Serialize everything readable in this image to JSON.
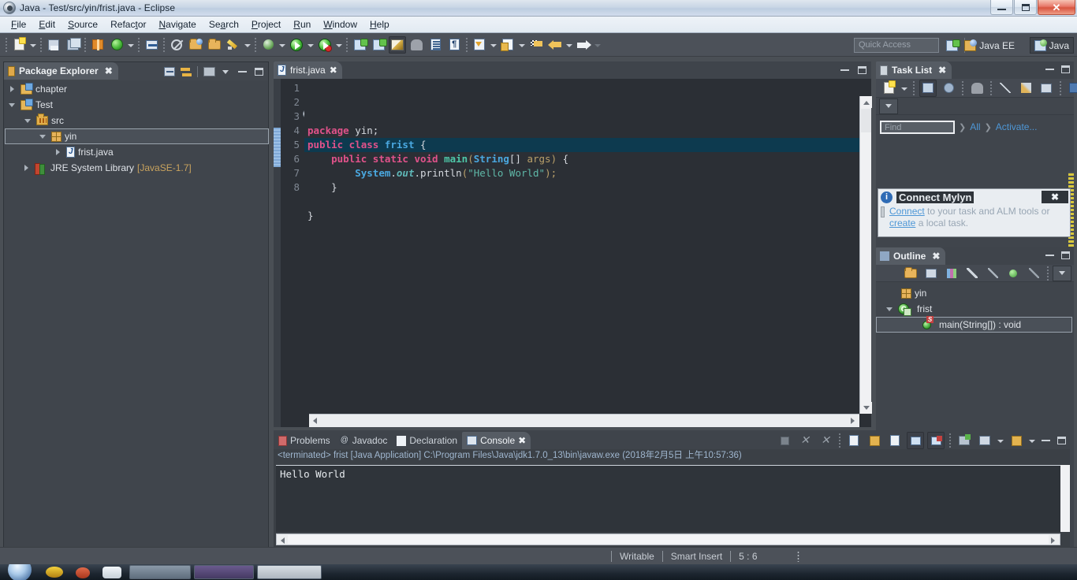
{
  "window": {
    "title": "Java - Test/src/yin/frist.java - Eclipse",
    "icon": "eclipse-icon",
    "minimize_label": "Minimize",
    "maximize_label": "Maximize",
    "close_label": "Close"
  },
  "menubar": {
    "items": [
      {
        "label": "File",
        "mnemonic": "F"
      },
      {
        "label": "Edit",
        "mnemonic": "E"
      },
      {
        "label": "Source",
        "mnemonic": "S"
      },
      {
        "label": "Refactor",
        "mnemonic": "t"
      },
      {
        "label": "Navigate",
        "mnemonic": "N"
      },
      {
        "label": "Search",
        "mnemonic": "a"
      },
      {
        "label": "Project",
        "mnemonic": "P"
      },
      {
        "label": "Run",
        "mnemonic": "R"
      },
      {
        "label": "Window",
        "mnemonic": "W"
      },
      {
        "label": "Help",
        "mnemonic": "H"
      }
    ]
  },
  "toolbar": {
    "quick_access_placeholder": "Quick Access",
    "perspective_java_ee": "Java EE",
    "perspective_java": "Java",
    "icons": [
      "new-wizard-icon",
      "save-icon",
      "save-all-icon",
      "new-java-project-icon",
      "build-refresh-icon",
      "toggle-breadcrumb-icon",
      "skip-breakpoints-icon",
      "open-type-icon",
      "open-task-icon",
      "edit-icon",
      "debug-icon",
      "run-icon",
      "run-last-tool-icon",
      "new-java-class-icon",
      "java-perspective-icon",
      "search-icon",
      "toggle-block-selection-icon",
      "show-whitespace-icon",
      "next-annotation-icon",
      "previous-annotation-icon",
      "back-icon",
      "forward-icon"
    ]
  },
  "package_explorer": {
    "title": "Package Explorer",
    "close_label": "✖",
    "tree": [
      {
        "label": "chapter",
        "icon": "java-project-icon",
        "state": "collapsed",
        "indent": 0,
        "selected": false
      },
      {
        "label": "Test",
        "icon": "java-project-icon",
        "state": "expanded",
        "indent": 0,
        "selected": false
      },
      {
        "label": "src",
        "icon": "source-folder-icon",
        "state": "expanded",
        "indent": 1,
        "selected": false
      },
      {
        "label": "yin",
        "icon": "package-icon",
        "state": "expanded",
        "indent": 2,
        "selected": true
      },
      {
        "label": "frist.java",
        "icon": "java-file-icon",
        "state": "collapsed",
        "indent": 3,
        "selected": false
      },
      {
        "label": "JRE System Library",
        "suffix": " [JavaSE-1.7]",
        "icon": "jre-library-icon",
        "state": "collapsed",
        "indent": 1,
        "selected": false
      }
    ]
  },
  "editor": {
    "tab_label": "frist.java",
    "tab_icon": "java-file-icon",
    "tab_close": "✖",
    "line_numbers": [
      "1",
      "2",
      "3",
      "4",
      "5",
      "6",
      "7",
      "8"
    ],
    "highlighted_line": 5,
    "folding_line": 3,
    "code_lines": [
      {
        "num": "1",
        "tokens": [
          {
            "t": "package",
            "c": "kw"
          },
          {
            "t": " yin;",
            "c": "pln"
          }
        ]
      },
      {
        "num": "2",
        "tokens": [
          {
            "t": "public class ",
            "c": "kw"
          },
          {
            "t": "frist",
            "c": "typ"
          },
          {
            "t": " {",
            "c": "pln"
          }
        ]
      },
      {
        "num": "3",
        "tokens": [
          {
            "t": "    ",
            "c": "pln"
          },
          {
            "t": "public static void ",
            "c": "kw"
          },
          {
            "t": "main",
            "c": "meth"
          },
          {
            "t": "(",
            "c": "par"
          },
          {
            "t": "String",
            "c": "typ"
          },
          {
            "t": "[] ",
            "c": "pln"
          },
          {
            "t": "args",
            "c": "par"
          },
          {
            "t": ") ",
            "c": "par"
          },
          {
            "t": "{",
            "c": "pln"
          }
        ]
      },
      {
        "num": "4",
        "tokens": [
          {
            "t": "        ",
            "c": "pln"
          },
          {
            "t": "System",
            "c": "typ"
          },
          {
            "t": ".",
            "c": "pln"
          },
          {
            "t": "out",
            "c": "fld"
          },
          {
            "t": ".",
            "c": "pln"
          },
          {
            "t": "println",
            "c": "pln"
          },
          {
            "t": "(",
            "c": "par"
          },
          {
            "t": "\"Hello World\"",
            "c": "str"
          },
          {
            "t": ");",
            "c": "par"
          }
        ]
      },
      {
        "num": "5",
        "tokens": [
          {
            "t": "    }",
            "c": "pln"
          }
        ]
      },
      {
        "num": "6",
        "tokens": [
          {
            "t": "",
            "c": "pln"
          }
        ]
      },
      {
        "num": "7",
        "tokens": [
          {
            "t": "}",
            "c": "pln"
          }
        ]
      },
      {
        "num": "8",
        "tokens": [
          {
            "t": "",
            "c": "pln"
          }
        ]
      }
    ]
  },
  "task_list": {
    "title": "Task List",
    "close_label": "✖",
    "find_placeholder": "Find",
    "link_all": "All",
    "link_activate": "Activate...",
    "chevron": "❯",
    "toolbar_icons": [
      "new-task-icon",
      "categorized-presentation-icon",
      "scheduled-presentation-icon",
      "focus-on-workweek-icon",
      "collapse-all-icon",
      "synchronize-changed-icon",
      "restore-task-list-icon",
      "view-menu-icon"
    ]
  },
  "mylyn_notification": {
    "title": "Connect Mylyn",
    "close_label": "✖",
    "info_glyph": "i",
    "text_before_link1": "",
    "link1": "Connect",
    "text_mid": " to your task and ALM tools or ",
    "link2": "create",
    "text_after": " a local task."
  },
  "outline": {
    "title": "Outline",
    "close_label": "✖",
    "toolbar_icons": [
      "focus-on-active-task-icon",
      "collapse-all-icon",
      "sort-icon",
      "hide-fields-icon",
      "hide-static-icon",
      "hide-nonpublic-icon",
      "hide-local-types-icon",
      "view-menu-icon"
    ],
    "tree": [
      {
        "label": "yin",
        "icon": "package-icon",
        "indent": 1,
        "state": "none",
        "selected": false
      },
      {
        "label": "frist",
        "icon": "class-icon",
        "indent": 1,
        "state": "expanded",
        "selected": false
      },
      {
        "label": "main(String[]) : void",
        "icon": "method-static-icon",
        "indent": 2,
        "state": "none",
        "selected": true
      }
    ]
  },
  "console": {
    "tabs": [
      {
        "label": "Problems",
        "icon": "problems-icon",
        "active": false
      },
      {
        "label": "Javadoc",
        "icon": "javadoc-icon",
        "active": false
      },
      {
        "label": "Declaration",
        "icon": "declaration-icon",
        "active": false
      },
      {
        "label": "Console",
        "icon": "console-icon",
        "active": true
      }
    ],
    "close_label": "✖",
    "status_line": "<terminated> frist [Java Application] C:\\Program Files\\Java\\jdk1.7.0_13\\bin\\javaw.exe (2018年2月5日 上午10:57:36)",
    "output": "Hello World",
    "toolbar_icons": [
      "terminate-icon",
      "remove-launch-icon",
      "remove-all-terminated-icon",
      "clear-console-icon",
      "scroll-lock-icon",
      "show-console-on-output-icon",
      "pin-console-icon",
      "display-selected-console-icon",
      "open-console-icon",
      "new-console-view-icon",
      "view-menu-icon",
      "minimize-icon",
      "maximize-icon"
    ]
  },
  "statusbar": {
    "writable": "Writable",
    "insert_mode": "Smart Insert",
    "cursor_position": "5 : 6"
  },
  "colors": {
    "chrome": "#4c5159",
    "panel": "#40454c",
    "editor_bg": "#2b2f35",
    "keyword": "#e0528a",
    "type": "#4aa8e0",
    "method": "#4ec7a8",
    "string": "#5fb8a8",
    "selection": "#0d3a4f",
    "link": "#4e97d6"
  }
}
